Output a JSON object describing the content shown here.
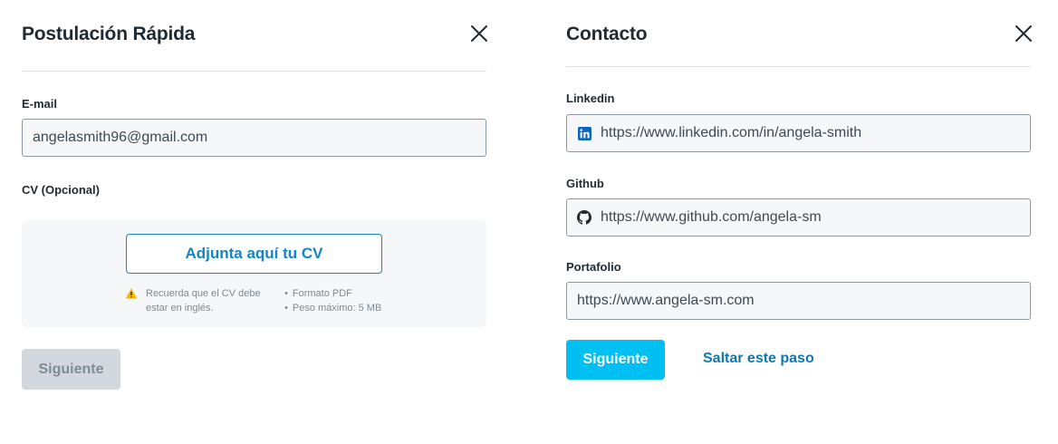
{
  "quick_apply": {
    "title": "Postulación Rápida",
    "email_label": "E-mail",
    "email_value": "angelasmith96@gmail.com",
    "cv_label": "CV (Opcional)",
    "attach_label": "Adjunta aquí tu CV",
    "hint_line1": "Recuerda que el CV debe",
    "hint_line2": "estar en inglés.",
    "requirements": [
      "Formato PDF",
      "Peso máximo: 5 MB"
    ],
    "next_label": "Siguiente"
  },
  "contact": {
    "title": "Contacto",
    "linkedin_label": "Linkedin",
    "linkedin_value": "https://www.linkedin.com/in/angela-smith",
    "github_label": "Github",
    "github_value": "https://www.github.com/angela-sm",
    "portfolio_label": "Portafolio",
    "portfolio_value": "https://www.angela-sm.com",
    "next_label": "Siguiente",
    "skip_label": "Saltar este paso"
  },
  "icons": {
    "close": "close-icon",
    "warning": "warning-icon",
    "linkedin": "linkedin-icon",
    "github": "github-icon"
  },
  "colors": {
    "accent_blue": "#1185c6",
    "primary_button": "#00bff3",
    "disabled_button": "#d2d8dd",
    "warning": "#f5b800",
    "linkedin": "#0a66c2"
  }
}
